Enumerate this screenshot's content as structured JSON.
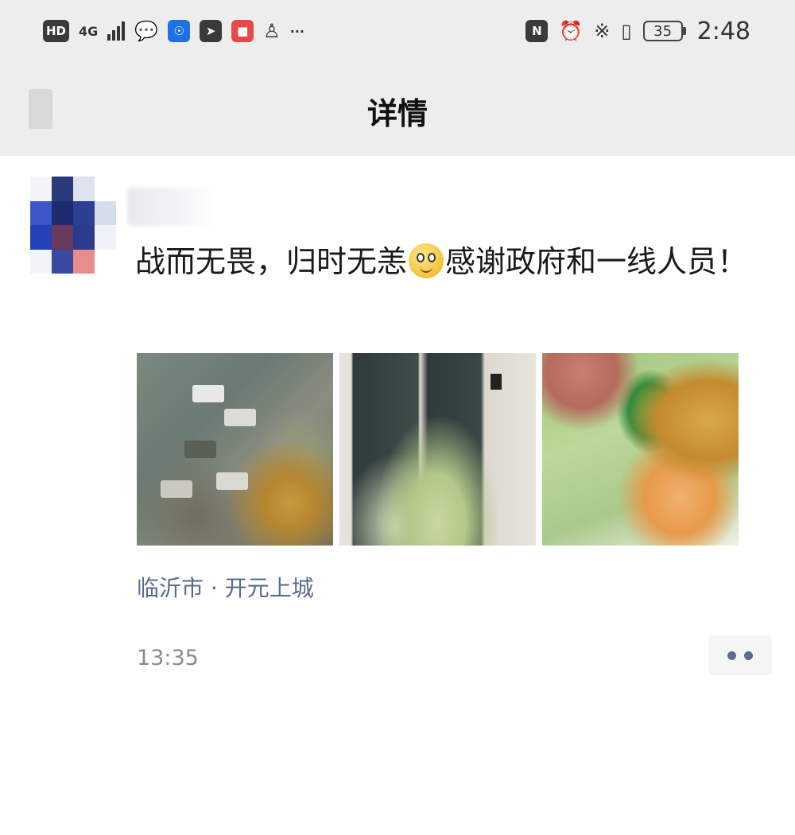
{
  "status_bar": {
    "hd": "HD",
    "network": "4G",
    "battery": "35",
    "time": "2:48",
    "more": "···",
    "icons_left": [
      "hd-icon",
      "signal-icon",
      "wechat-icon",
      "lightbulb-icon",
      "app-icon",
      "tile-icon",
      "qq-icon",
      "more-notifications-icon"
    ],
    "icons_right": [
      "nfc-icon",
      "alarm-icon",
      "bluetooth-icon",
      "vibrate-icon",
      "battery-icon"
    ]
  },
  "header": {
    "title": "详情"
  },
  "post": {
    "text_before_emoji": "战而无畏，归时无恙",
    "emoji": "smiley-face",
    "text_after_emoji": "感谢政府和一线人员！",
    "photos": [
      "aerial-street-photo",
      "doorway-vegetables-photo",
      "vegetable-bags-photo"
    ],
    "location": "临沂市 · 开元上城",
    "time": "13:35"
  },
  "colors": {
    "header_bg": "#ededed",
    "link": "#5b6b8c",
    "muted": "#8a8a8a"
  }
}
